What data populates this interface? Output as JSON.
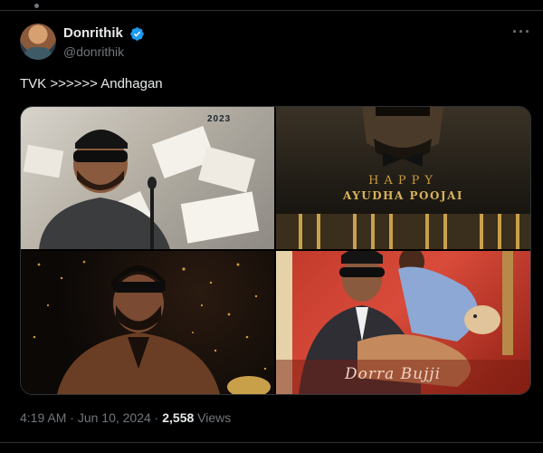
{
  "author": {
    "display_name": "Donrithik",
    "handle": "@donrithik",
    "verified": true,
    "verified_color": "#1d9bf0"
  },
  "menu": {
    "icon": "more-horizontal-icon",
    "glyph": "···"
  },
  "tweet": {
    "text": "TVK >>>>>> Andhagan"
  },
  "media": {
    "tile1": {
      "overlay_text": "2023"
    },
    "tile2": {
      "line1": "HAPPY",
      "line2": "AYUDHA POOJAI"
    },
    "tile3": {},
    "tile4": {
      "overlay_text": "Dorra Bujji"
    }
  },
  "meta": {
    "time": "4:19 AM",
    "separator1": " · ",
    "date": "Jun 10, 2024",
    "separator2": " · ",
    "views_count": "2,558",
    "views_label": " Views"
  },
  "colors": {
    "background": "#000000",
    "text_primary": "#e7e9ea",
    "text_secondary": "#71767b",
    "border": "#2f3336"
  }
}
